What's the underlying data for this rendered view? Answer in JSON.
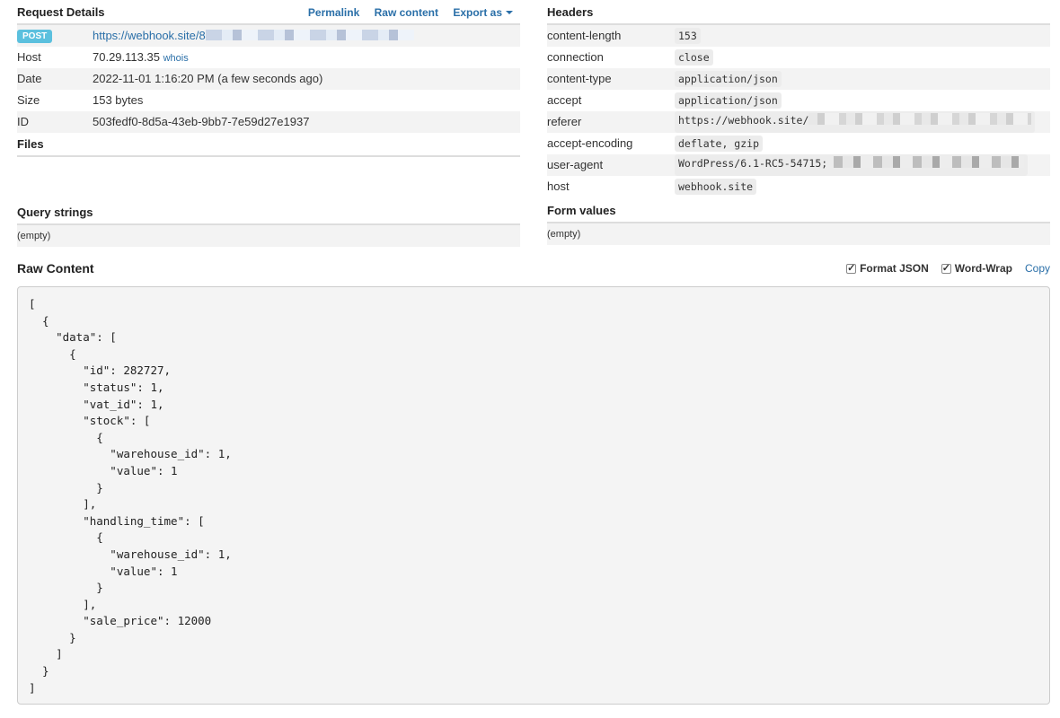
{
  "request": {
    "title": "Request Details",
    "links": {
      "permalink": "Permalink",
      "raw_content": "Raw content",
      "export_as": "Export as"
    },
    "method": "POST",
    "url_prefix": "https://webhook.site/8",
    "rows": [
      {
        "label": "Host",
        "value": "70.29.113.35",
        "extra": "whois"
      },
      {
        "label": "Date",
        "value": "2022-11-01 1:16:20 PM (a few seconds ago)"
      },
      {
        "label": "Size",
        "value": "153 bytes"
      },
      {
        "label": "ID",
        "value": "503fedf0-8d5a-43eb-9bb7-7e59d27e1937"
      }
    ]
  },
  "files": {
    "title": "Files"
  },
  "query": {
    "title": "Query strings",
    "empty": "(empty)"
  },
  "headers": {
    "title": "Headers",
    "rows": [
      {
        "name": "content-length",
        "value": "153"
      },
      {
        "name": "connection",
        "value": "close"
      },
      {
        "name": "content-type",
        "value": "application/json"
      },
      {
        "name": "accept",
        "value": "application/json"
      },
      {
        "name": "referer",
        "value": "https://webhook.site/"
      },
      {
        "name": "accept-encoding",
        "value": "deflate, gzip"
      },
      {
        "name": "user-agent",
        "value": "WordPress/6.1-RC5-54715;"
      },
      {
        "name": "host",
        "value": "webhook.site"
      }
    ]
  },
  "form": {
    "title": "Form values",
    "empty": "(empty)"
  },
  "raw": {
    "title": "Raw Content",
    "format_json": "Format JSON",
    "word_wrap": "Word-Wrap",
    "copy": "Copy",
    "content": "[\n  {\n    \"data\": [\n      {\n        \"id\": 282727,\n        \"status\": 1,\n        \"vat_id\": 1,\n        \"stock\": [\n          {\n            \"warehouse_id\": 1,\n            \"value\": 1\n          }\n        ],\n        \"handling_time\": [\n          {\n            \"warehouse_id\": 1,\n            \"value\": 1\n          }\n        ],\n        \"sale_price\": 12000\n      }\n    ]\n  }\n]"
  }
}
